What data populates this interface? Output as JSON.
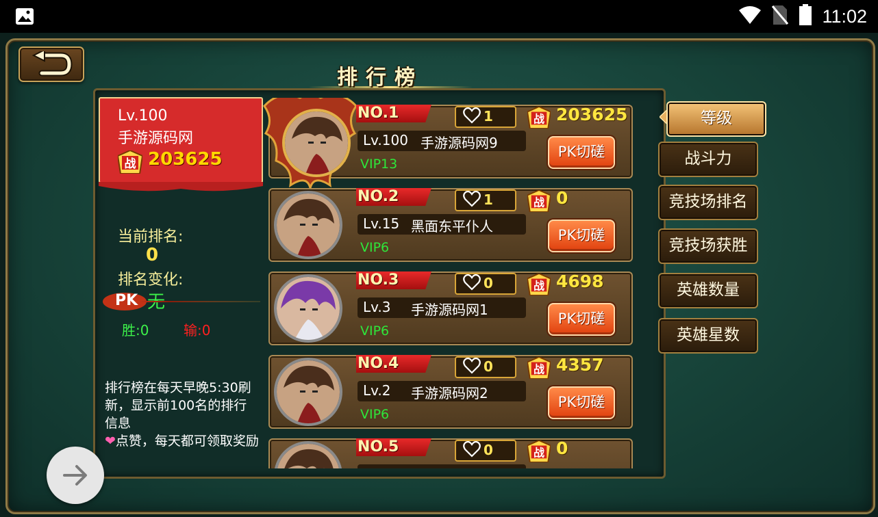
{
  "status_bar": {
    "time": "11:02",
    "icons": [
      "image-icon",
      "wifi-icon",
      "no-sim-icon",
      "battery-icon"
    ]
  },
  "title": "排行榜",
  "player": {
    "level": "Lv.100",
    "name": "手游源码网",
    "power": "203625"
  },
  "rank_info": {
    "current_rank_label": "当前排名:",
    "current_rank_value": "0",
    "rank_change_label": "排名变化:",
    "rank_change_value": "无"
  },
  "pk": {
    "label": "PK",
    "win": "胜:0",
    "lose": "输:0"
  },
  "info": {
    "refresh_note": "排行榜在每天早晚5:30刷新，显示前100名的排行信息",
    "like_note": "点赞，每天都可领取奖励"
  },
  "pk_button_label": "PK切磋",
  "zhan_char": "战",
  "rankings": [
    {
      "no": "NO.1",
      "likes": "1",
      "power": "203625",
      "level": "Lv.100",
      "name": "手游源码网9",
      "vip": "VIP13"
    },
    {
      "no": "NO.2",
      "likes": "1",
      "power": "0",
      "level": "Lv.15",
      "name": "黑面东平仆人",
      "vip": "VIP6"
    },
    {
      "no": "NO.3",
      "likes": "0",
      "power": "4698",
      "level": "Lv.3",
      "name": "手游源码网1",
      "vip": "VIP6"
    },
    {
      "no": "NO.4",
      "likes": "0",
      "power": "4357",
      "level": "Lv.2",
      "name": "手游源码网2",
      "vip": "VIP6"
    },
    {
      "no": "NO.5",
      "likes": "0",
      "power": "0",
      "level": "",
      "name": "",
      "vip": ""
    }
  ],
  "tabs": [
    "等级",
    "战斗力",
    "竞技场排名",
    "竞技场获胜",
    "英雄数量",
    "英雄星数"
  ],
  "active_tab_index": 0,
  "colors": {
    "background": "#174339",
    "banner_red": "#d62b2b",
    "gold": "#ffe640",
    "vip_green": "#2ee63a",
    "pk_orange": "#e0400e"
  }
}
